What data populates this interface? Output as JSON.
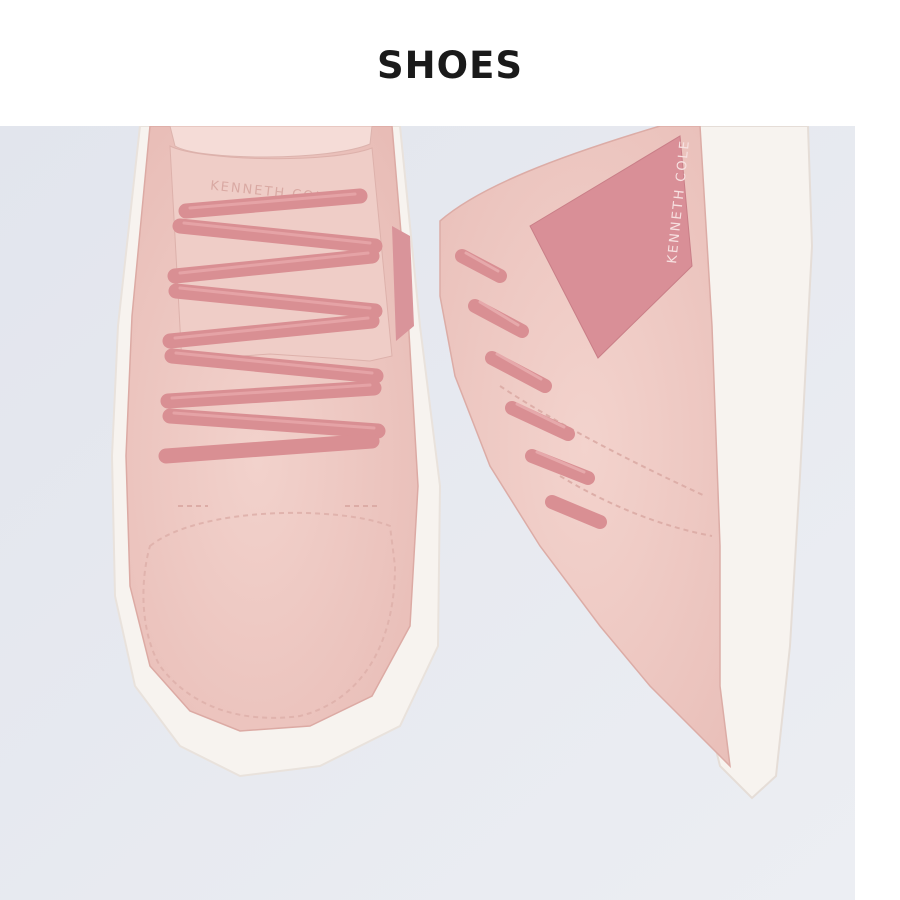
{
  "header": {
    "title": "SHOES"
  },
  "photo": {
    "brand_left": "KENNETH COLE",
    "brand_right": "KENNETH COLE",
    "colors": {
      "background": "#e7e9ef",
      "suede": "#efc9c4",
      "laces": "#d98f93",
      "leather_stripe": "#d98f97",
      "sole": "#f6f2ee"
    }
  }
}
